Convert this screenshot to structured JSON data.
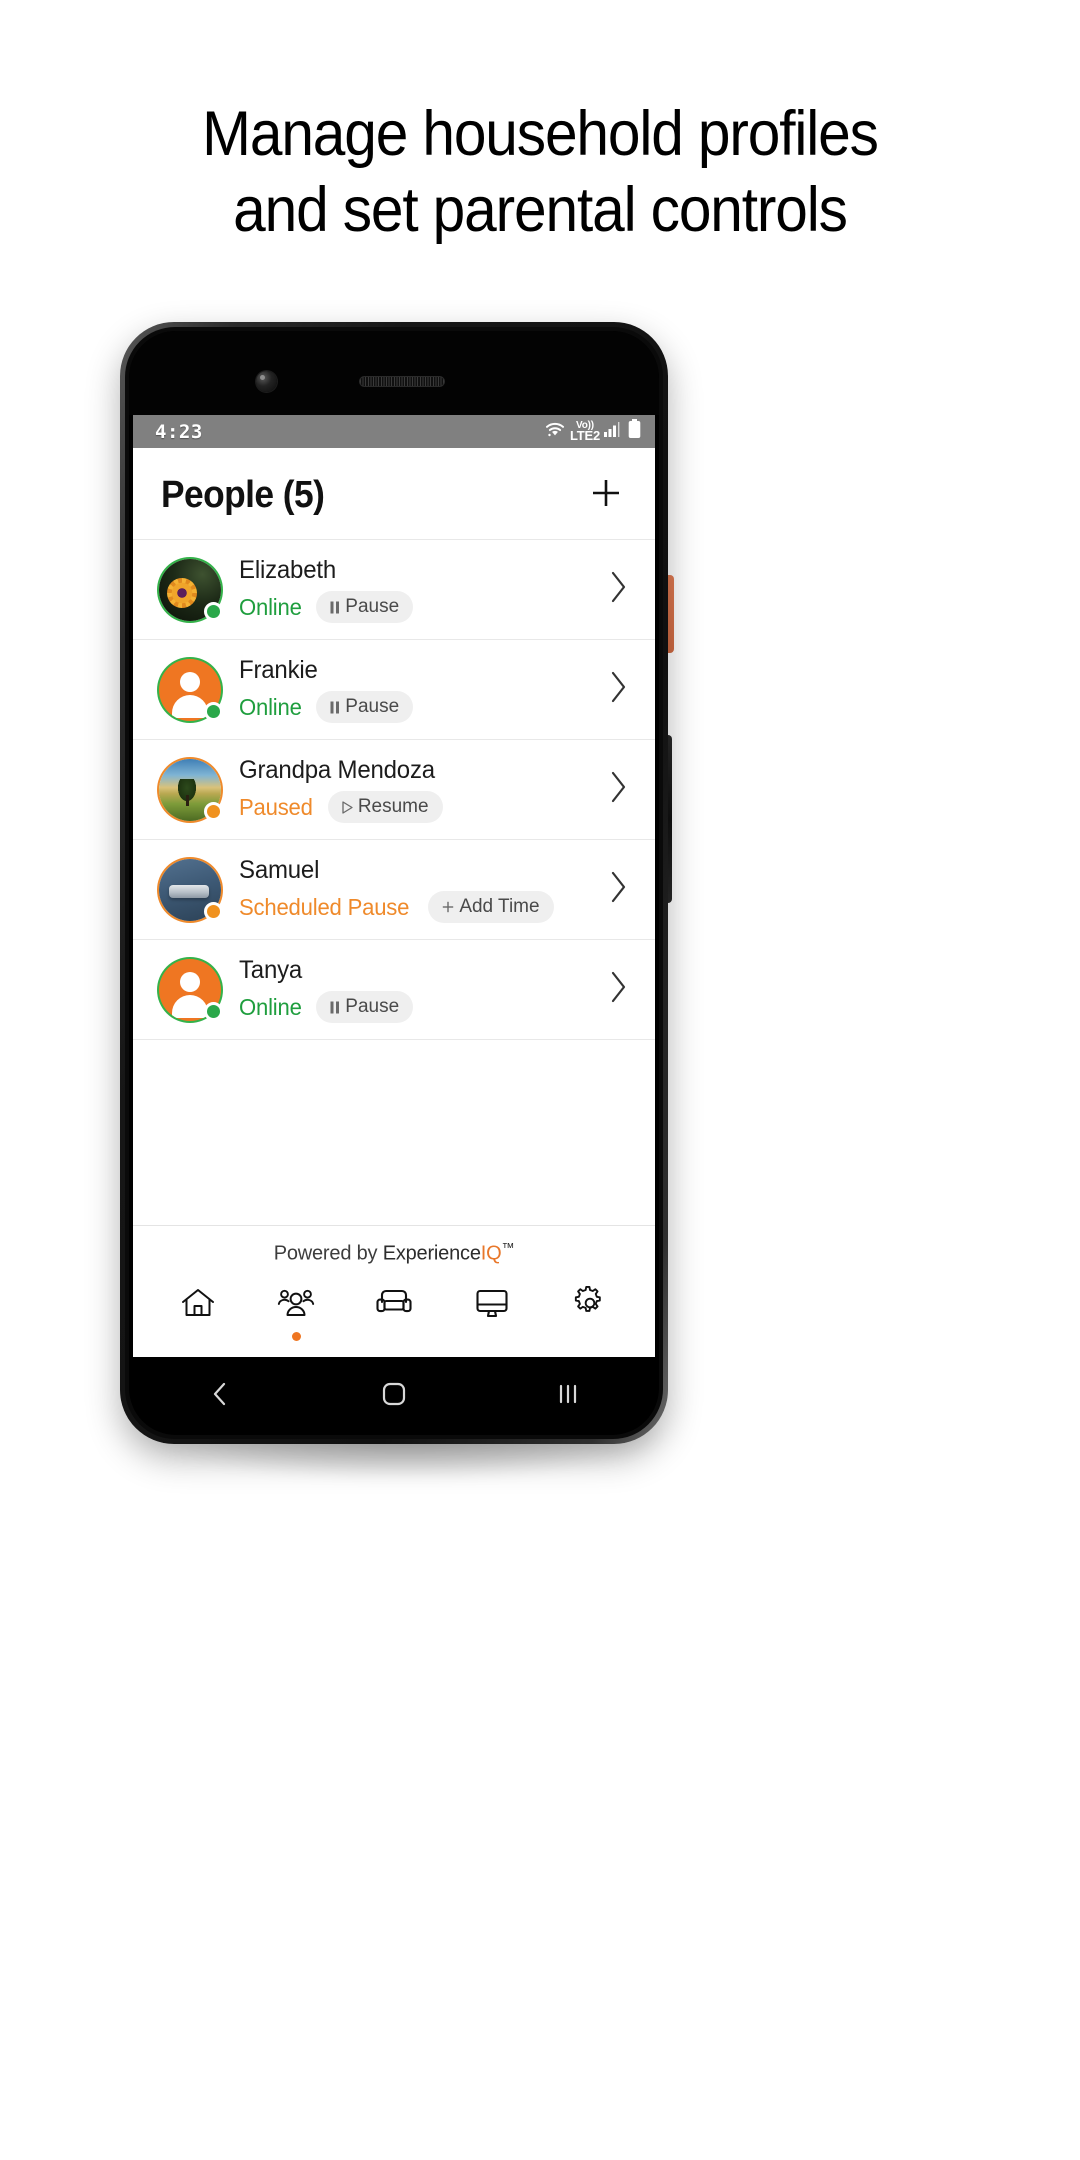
{
  "headline": {
    "line1": "Manage household profiles",
    "line2": "and set parental controls"
  },
  "phone": {
    "status_bar": {
      "time": "4:23",
      "wifi_icon": "wifi-icon",
      "volte_top": "Vo))",
      "volte_bottom": "LTE2",
      "signal_icon": "signal-bars-icon",
      "battery_icon": "battery-icon"
    },
    "app": {
      "header": {
        "title": "People (5)",
        "add_icon": "plus-icon"
      },
      "people": [
        {
          "name": "Elizabeth",
          "status": "Online",
          "status_type": "online",
          "action_label": "Pause",
          "action_icon": "pause-icon",
          "avatar_type": "sunflower-photo",
          "chevron_icon": "chevron-right-icon"
        },
        {
          "name": "Frankie",
          "status": "Online",
          "status_type": "online",
          "action_label": "Pause",
          "action_icon": "pause-icon",
          "avatar_type": "person-placeholder",
          "chevron_icon": "chevron-right-icon"
        },
        {
          "name": "Grandpa Mendoza",
          "status": "Paused",
          "status_type": "paused",
          "action_label": "Resume",
          "action_icon": "play-icon",
          "avatar_type": "landscape-photo",
          "chevron_icon": "chevron-right-icon"
        },
        {
          "name": "Samuel",
          "status": "Scheduled Pause",
          "status_type": "paused",
          "action_label": "Add Time",
          "action_icon": "plus-icon",
          "avatar_type": "blue-object-photo",
          "chevron_icon": "chevron-right-icon"
        },
        {
          "name": "Tanya",
          "status": "Online",
          "status_type": "online",
          "action_label": "Pause",
          "action_icon": "pause-icon",
          "avatar_type": "person-placeholder",
          "chevron_icon": "chevron-right-icon"
        }
      ],
      "footer": {
        "powered_prefix": "Powered by ",
        "brand_main": "Experience",
        "brand_accent": "IQ",
        "brand_tm": "™"
      },
      "tabs": [
        {
          "name": "home",
          "icon": "home-icon",
          "active": false
        },
        {
          "name": "people",
          "icon": "people-icon",
          "active": true
        },
        {
          "name": "devices-furniture",
          "icon": "sofa-icon",
          "active": false
        },
        {
          "name": "network",
          "icon": "monitor-icon",
          "active": false
        },
        {
          "name": "settings",
          "icon": "gear-icon",
          "active": false
        }
      ]
    },
    "android_nav": {
      "back_icon": "back-chevron-icon",
      "home_icon": "home-square-icon",
      "recents_icon": "recents-icon"
    }
  },
  "colors": {
    "accent_orange": "#ef7622",
    "online_green": "#1f9e3e",
    "paused_orange": "#ef8a2b",
    "status_bar_gray": "#808080"
  }
}
